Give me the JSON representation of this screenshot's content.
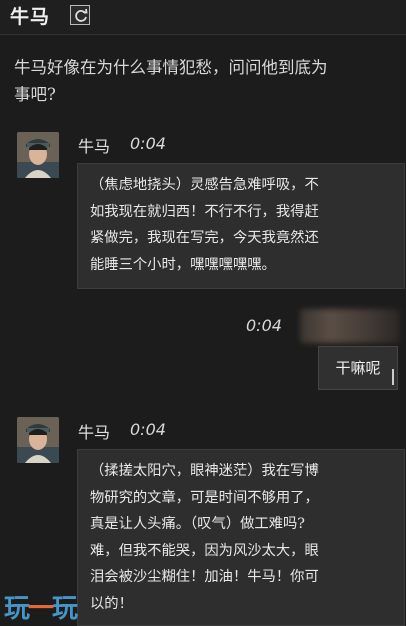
{
  "header": {
    "title": "牛马",
    "refresh_icon": "refresh-icon"
  },
  "intro": {
    "line1": "牛马好像在为什么事情犯愁，问问他到底为",
    "line2": "事吧?"
  },
  "messages": [
    {
      "sender": "牛马",
      "time": "0:04",
      "lines": [
        "（焦虑地挠头）灵感告急难呼吸，不",
        "如我现在就归西！不行不行，我得赶",
        "紧做完，我现在写完，今天我竟然还",
        "能睡三个小时，嘿嘿嘿嘿嘿。"
      ]
    },
    {
      "time": "0:04",
      "reply": "干嘛呢"
    },
    {
      "sender": "牛马",
      "time": "0:04",
      "lines": [
        "（揉搓太阳穴，眼神迷茫）我在写博",
        "物研究的文章，可是时间不够用了，",
        "真是让人头痛。（叹气）做工难吗?",
        "难，但我不能哭，因为风沙太大，眼",
        "泪会被沙尘糊住！加油！牛马！你可",
        "以的！"
      ]
    }
  ],
  "watermark": {
    "left": "玩",
    "mid": "一",
    "right": "玩"
  }
}
